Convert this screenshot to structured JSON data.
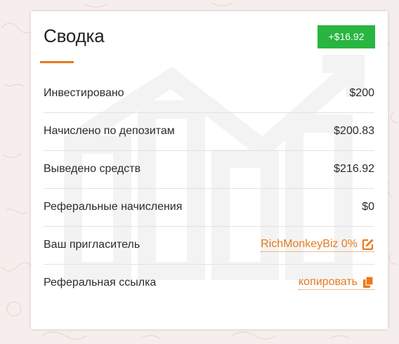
{
  "summary": {
    "title": "Сводка",
    "total_badge": "+$16.92",
    "rows": [
      {
        "label": "Инвестировано",
        "value": "$200"
      },
      {
        "label": "Начислено по депозитам",
        "value": "$200.83"
      },
      {
        "label": "Выведено средств",
        "value": "$216.92"
      },
      {
        "label": "Реферальные начисления",
        "value": "$0"
      },
      {
        "label": "Ваш пригласитель",
        "value": "RichMonkeyBiz 0%",
        "icon": "edit-icon"
      },
      {
        "label": "Реферальная ссылка",
        "value": "копировать",
        "icon": "copy-icon"
      }
    ]
  },
  "colors": {
    "accent": "#e8791d",
    "badge": "#28b540",
    "background": "#f6eeec"
  }
}
